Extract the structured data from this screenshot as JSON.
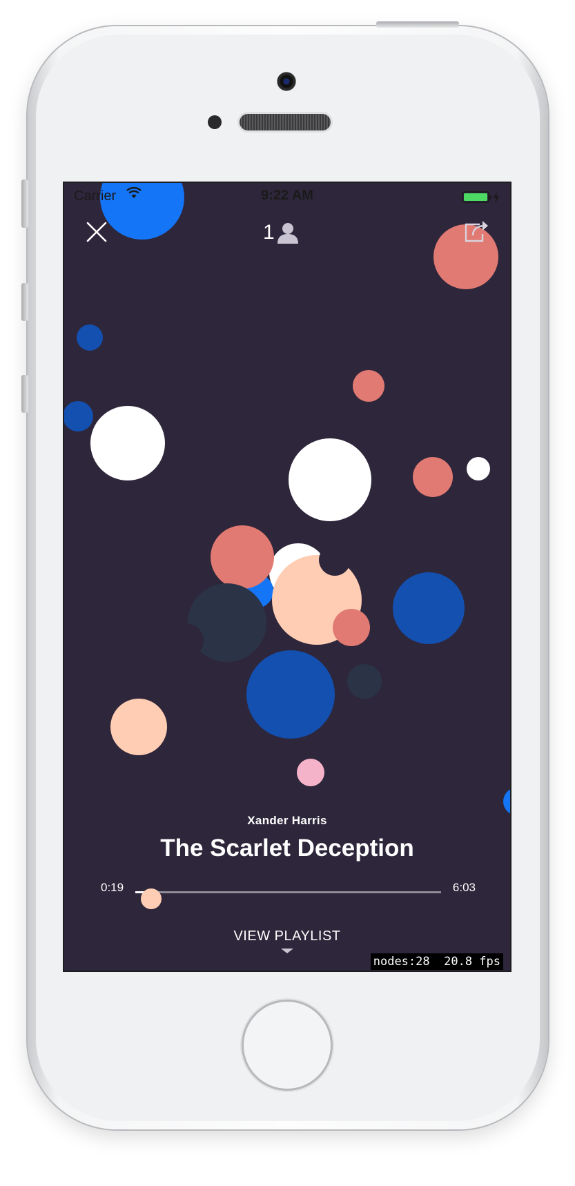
{
  "status_bar": {
    "carrier": "Carrier",
    "time": "9:22 AM",
    "battery_color": "#4cd964",
    "wifi_icon": "wifi-icon",
    "charging_icon": "bolt-icon"
  },
  "header": {
    "close_icon": "close-icon",
    "listener_count": "1",
    "listener_icon": "person-icon",
    "share_icon": "share-icon"
  },
  "track": {
    "artist": "Xander Harris",
    "title": "The Scarlet Deception"
  },
  "player": {
    "elapsed": "0:19",
    "duration": "6:03",
    "progress_fraction": 0.0525
  },
  "playlist": {
    "label": "VIEW PLAYLIST",
    "icon": "chevron-down-icon"
  },
  "debug": {
    "nodes": "nodes:28",
    "fps": "20.8 fps"
  },
  "colors": {
    "background": "#2e263b",
    "blue": "#1575f7",
    "dark_blue": "#1350b0",
    "coral": "#e17a72",
    "white": "#ffffff",
    "peach": "#fecdb3",
    "slate": "#2b3447",
    "pink": "#f5b3c9"
  }
}
